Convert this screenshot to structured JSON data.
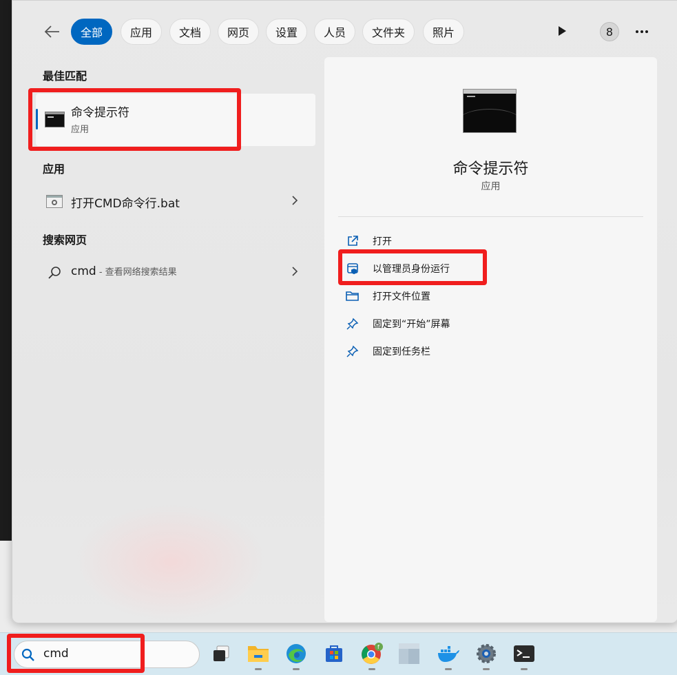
{
  "filters": {
    "items": [
      "全部",
      "应用",
      "文档",
      "网页",
      "设置",
      "人员",
      "文件夹",
      "照片"
    ],
    "active_index": 0,
    "badge_count": "8"
  },
  "left": {
    "best_match_title": "最佳匹配",
    "best_match": {
      "name": "命令提示符",
      "sub": "应用"
    },
    "apps_title": "应用",
    "app_item": "打开CMD命令行.bat",
    "web_title": "搜索网页",
    "web_item": {
      "query": "cmd",
      "sub": " - 查看网络搜索结果"
    }
  },
  "detail": {
    "title": "命令提示符",
    "sub": "应用",
    "actions": [
      "打开",
      "以管理员身份运行",
      "打开文件位置",
      "固定到“开始”屏幕",
      "固定到任务栏"
    ]
  },
  "taskbar": {
    "search_text": "cmd",
    "apps": [
      "task-view-icon",
      "file-explorer-icon",
      "edge-icon",
      "store-icon",
      "chrome-icon",
      "app-icon",
      "docker-icon",
      "settings-icon",
      "terminal-icon"
    ]
  },
  "colors": {
    "accent": "#0067c0",
    "highlight": "#f01e1e",
    "taskbar": "#d5e8f1"
  }
}
